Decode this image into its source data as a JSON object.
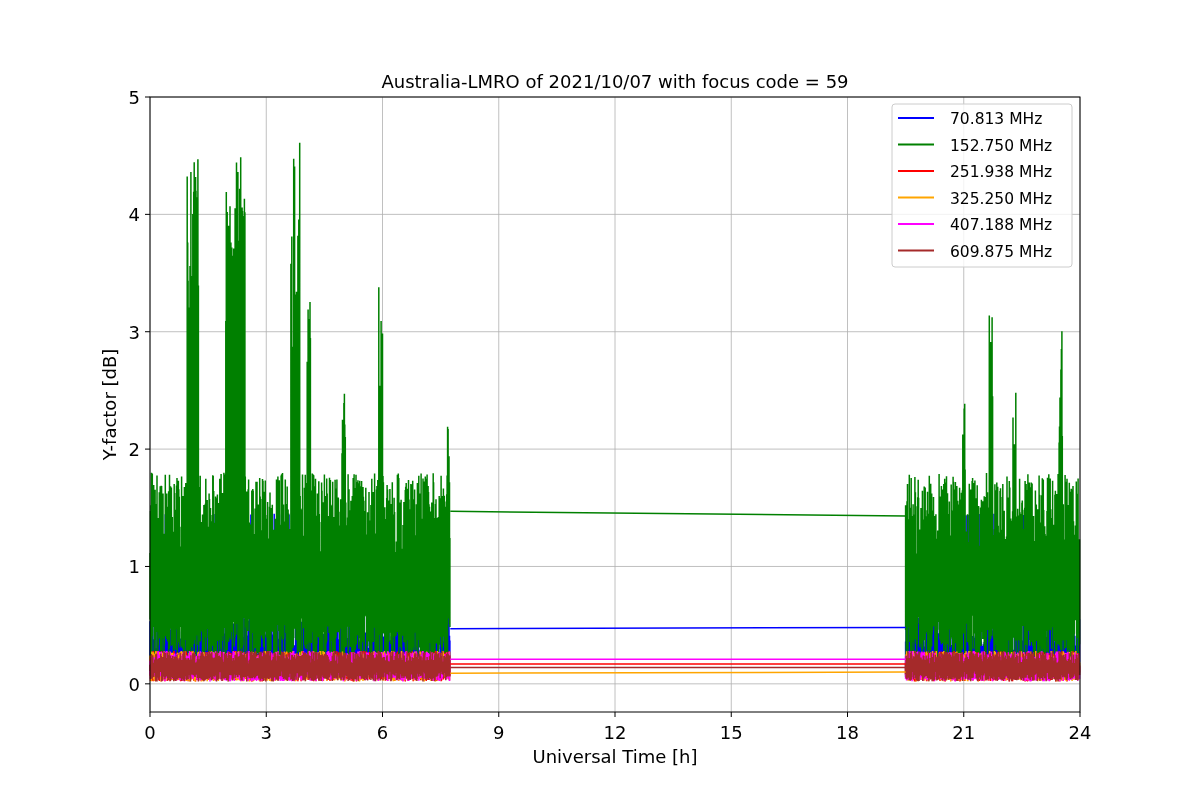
{
  "chart": {
    "chart_data": {
      "type": "line",
      "title": "Australia-LMRO of 2021/10/07 with focus code = 59",
      "xlabel": "Universal Time [h]",
      "ylabel": "Y-factor [dB]",
      "x": [
        7.75,
        19.5
      ],
      "series": [
        {
          "name": "70.813 MHz",
          "color": "#0000ff",
          "values": [
            0.47,
            0.48
          ]
        },
        {
          "name": "152.750 MHz",
          "color": "#008000",
          "values": [
            1.47,
            1.43
          ]
        },
        {
          "name": "251.938 MHz",
          "color": "#ff0000",
          "values": [
            0.17,
            0.17
          ]
        },
        {
          "name": "325.250 MHz",
          "color": "#ffa500",
          "values": [
            0.09,
            0.1
          ]
        },
        {
          "name": "407.188 MHz",
          "color": "#ff00ff",
          "values": [
            0.21,
            0.21
          ]
        },
        {
          "name": "609.875 MHz",
          "color": "#a52a2a",
          "values": [
            0.14,
            0.14
          ]
        }
      ],
      "grid": true,
      "legend": true,
      "xlim": [
        0,
        24
      ],
      "ylim": [
        -0.24,
        5
      ],
      "xticks": [
        0,
        3,
        6,
        9,
        12,
        15,
        18,
        21,
        24
      ],
      "yticks": [
        0,
        1,
        2,
        3,
        4,
        5
      ]
    }
  }
}
